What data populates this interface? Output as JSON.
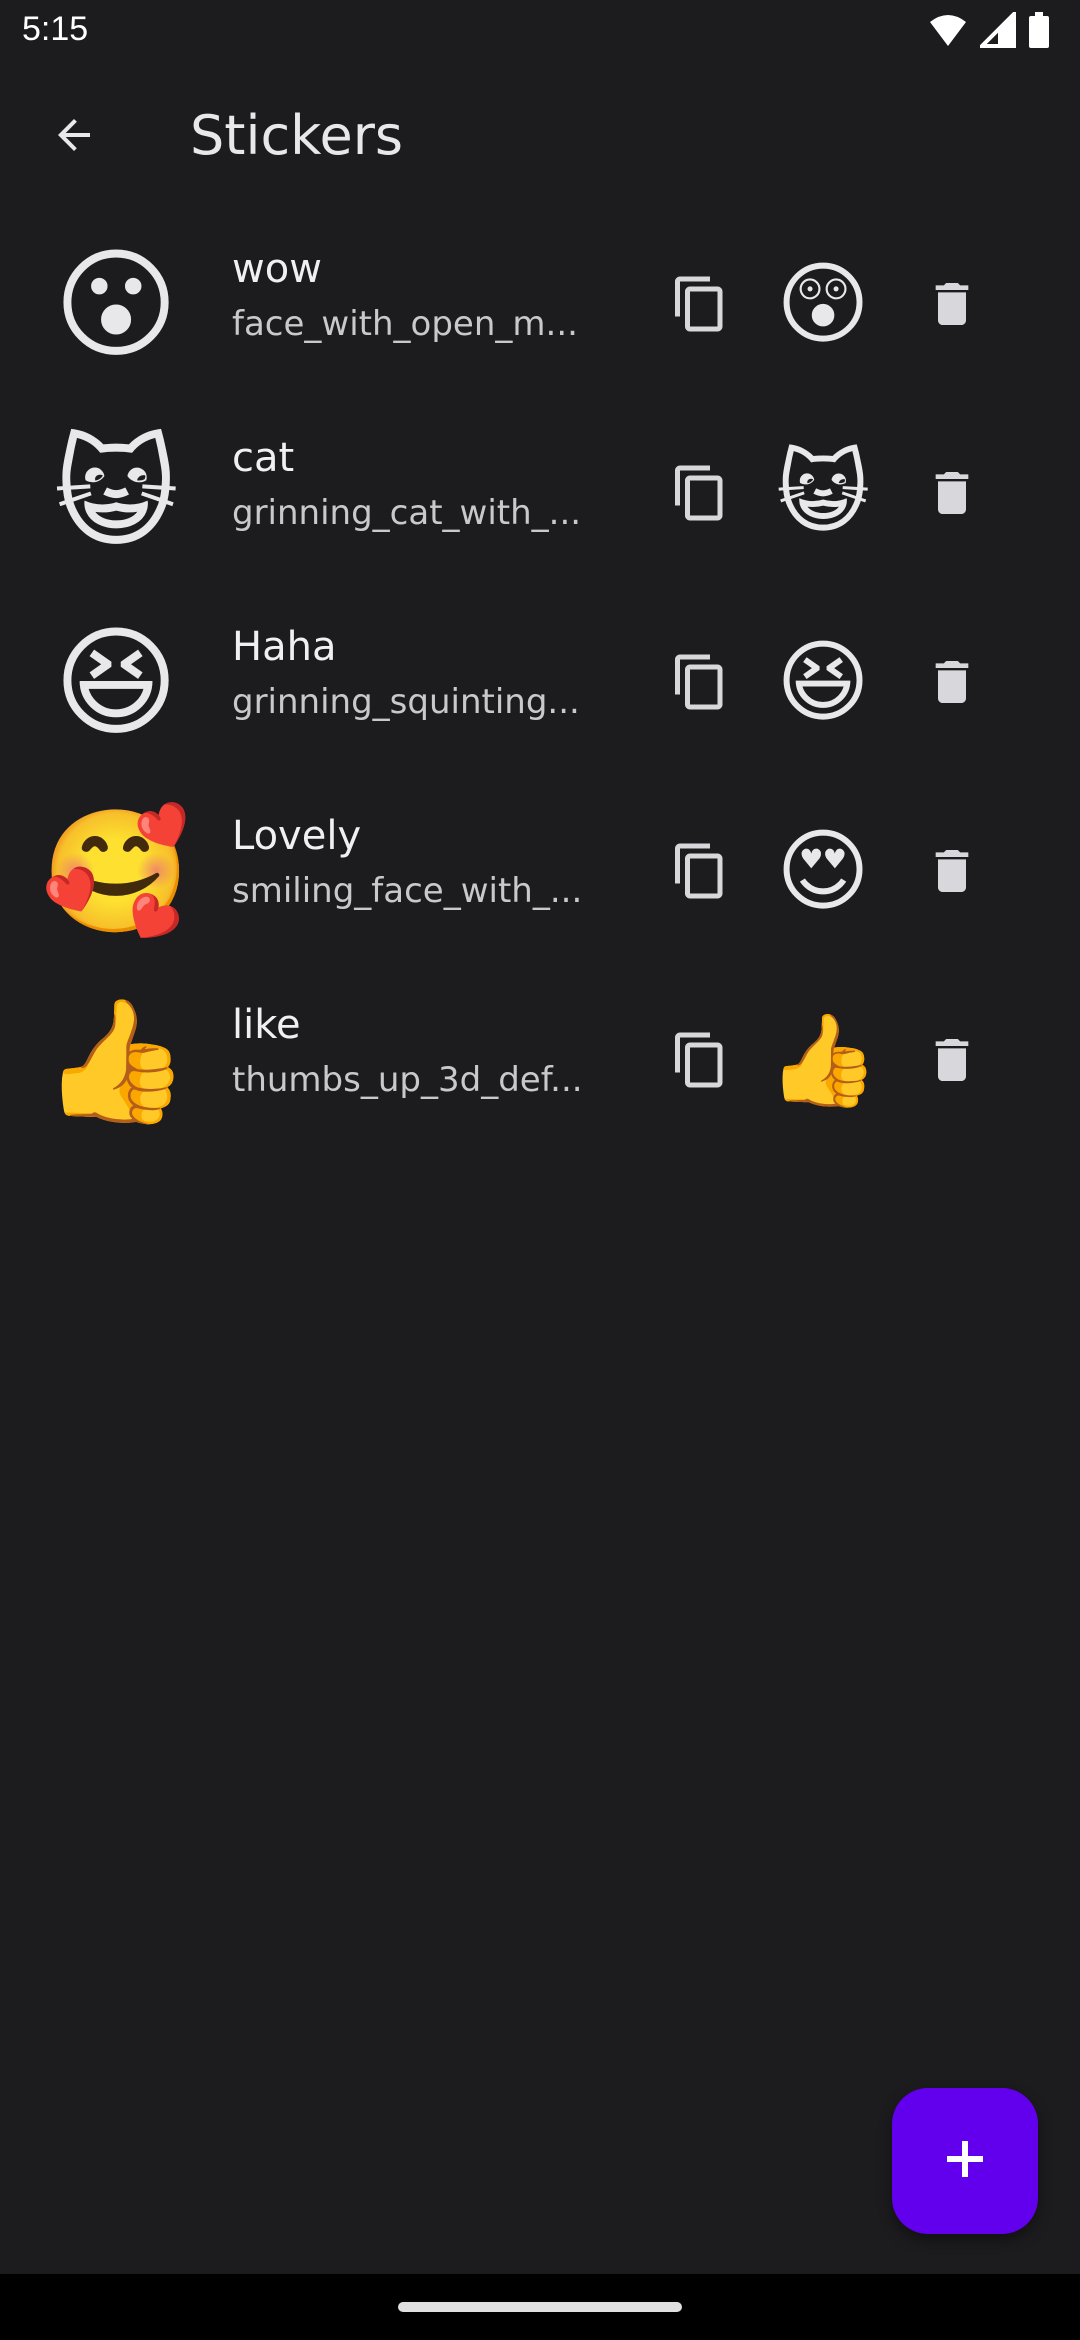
{
  "status_bar": {
    "time": "5:15",
    "icons": [
      "wifi-icon",
      "signal-icon",
      "battery-icon"
    ]
  },
  "app_bar": {
    "title": "Stickers",
    "back_icon": "arrow-back-icon"
  },
  "stickers": [
    {
      "name": "wow",
      "code": "face_with_open_m...",
      "image": "😮",
      "emoji": "😲"
    },
    {
      "name": "cat",
      "code": "grinning_cat_with_...",
      "image": "😺",
      "emoji": "😺"
    },
    {
      "name": "Haha",
      "code": "grinning_squinting...",
      "image": "😆",
      "emoji": "😆"
    },
    {
      "name": "Lovely",
      "code": "smiling_face_with_...",
      "image": "🥰",
      "emoji": "😍"
    },
    {
      "name": "like",
      "code": "thumbs_up_3d_def...",
      "image": "👍",
      "emoji": "👍"
    }
  ],
  "fab": {
    "icon": "plus-icon",
    "color": "#6200ee"
  },
  "colors": {
    "background": "#1c1c1e",
    "text_primary": "#f0f0f2",
    "text_secondary": "#c9c9cc",
    "icon": "#d8d8dc"
  }
}
